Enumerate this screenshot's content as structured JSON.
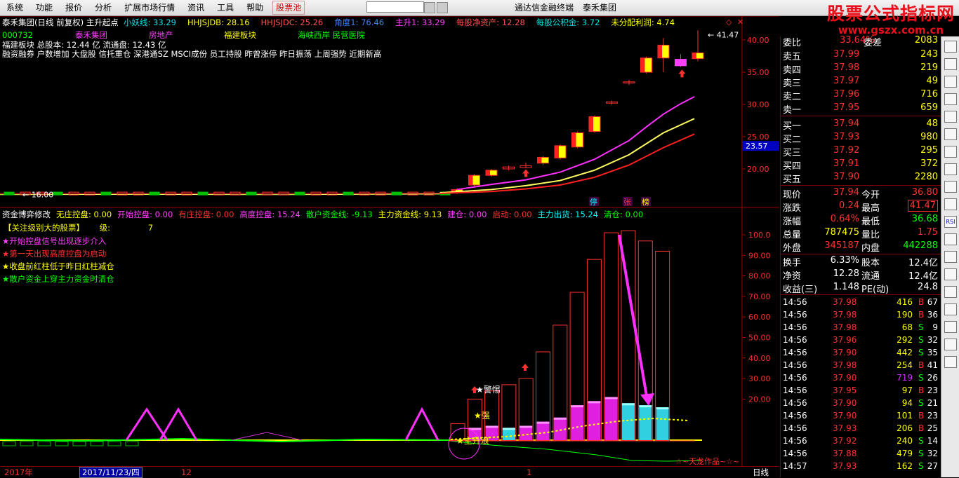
{
  "menu": {
    "items": [
      "系统",
      "功能",
      "报价",
      "分析",
      "扩展市场行情",
      "资讯",
      "工具",
      "帮助"
    ],
    "hot": "股票池",
    "app_title": "通达信金融终端",
    "stock_name": "泰禾集团"
  },
  "watermark": {
    "line1": "股票公式指标网",
    "line2": "www.gszx.com.cn"
  },
  "main": {
    "title": "泰禾集团(日线 前复权) 主升起点",
    "indicators": [
      {
        "label": "小妖线: 33.29",
        "color": "#00e6e6"
      },
      {
        "label": "HHJSJDB: 28.16",
        "color": "#ffff00"
      },
      {
        "label": "HHJSJDC: 25.26",
        "color": "#ff5050"
      },
      {
        "label": "角度1: 76.46",
        "color": "#3f7fff"
      },
      {
        "label": "主升1: 33.29",
        "color": "#ff40ff"
      },
      {
        "label": "每股净资产: 12.28",
        "color": "#ff5050"
      },
      {
        "label": "每股公积金: 3.72",
        "color": "#00e0e0"
      },
      {
        "label": "未分配利润: 4.74",
        "color": "#ffff00"
      }
    ],
    "row2": [
      {
        "label": "000732",
        "color": "#00ff00"
      },
      {
        "label": "泰禾集团",
        "color": "#ff40ff"
      },
      {
        "label": "房地产",
        "color": "#ff40ff"
      },
      {
        "label": "福建板块",
        "color": "#ffff00"
      },
      {
        "label": "海峡西岸 民营医院",
        "color": "#00ff00"
      }
    ],
    "row3": "福建板块  总股本: 12.44 亿      流通盘: 12.43 亿",
    "row4": "融资融券 户数增加 大盘股 信托重仓 深港通SZ MSCI成份 员工持股 昨曾涨停 昨日振荡 上周强势 近期新高",
    "price_ticks": [
      "40.00",
      "35.00",
      "30.00",
      "25.00",
      "20.00"
    ],
    "current_price_tag": "23.57",
    "high_label": "41.47",
    "low_label": "16.00",
    "tags": [
      "停",
      "张",
      "榜"
    ]
  },
  "sub": {
    "title_items": [
      {
        "label": "资金博弈修改",
        "color": "#ffffff"
      },
      {
        "label": "无庄控盘: 0.00",
        "color": "#ffff00"
      },
      {
        "label": "开始控盘: 0.00",
        "color": "#ff40ff"
      },
      {
        "label": "有庄控盘: 0.00",
        "color": "#ff3030"
      },
      {
        "label": "高度控盘: 15.24",
        "color": "#ff40ff"
      },
      {
        "label": "散户资金线: -9.13",
        "color": "#00ff00"
      },
      {
        "label": "主力资金线: 9.13",
        "color": "#ffff00"
      },
      {
        "label": "建仓: 0.00",
        "color": "#ff40ff"
      },
      {
        "label": "启动: 0.00",
        "color": "#ff3030"
      },
      {
        "label": "主力出货: 15.24",
        "color": "#00ffff"
      },
      {
        "label": "清仓: 0.00",
        "color": "#00ff00"
      }
    ],
    "focus": "【关注级别大的股票】",
    "level_label": "级:",
    "level_value": "7",
    "legend": [
      {
        "text": "★开始控盘信号出现逐步介入",
        "color": "#ff40ff"
      },
      {
        "text": "★第一天出现高度控盘为启动",
        "color": "#ff3030"
      },
      {
        "text": "★收盘前红柱低于昨日红柱减仓",
        "color": "#ffff00"
      },
      {
        "text": "★散户资金上穿主力资金时清仓",
        "color": "#00ff00"
      }
    ],
    "ticks": [
      "100.0",
      "90.00",
      "80.00",
      "70.00",
      "60.00",
      "50.00",
      "40.00",
      "30.00",
      "20.00"
    ],
    "annot_warn": "★警惕",
    "annot_strong": "★强",
    "annot_main": "★主升浪",
    "signature": "☆~天龙作品~☆~"
  },
  "bottom": {
    "year": "2017年",
    "date": "2017/11/23/四",
    "m12": "12",
    "m1": "1",
    "period": "日线"
  },
  "orderbook": {
    "header": {
      "label1": "委比",
      "val1": "33.64%",
      "label2": "委差",
      "val2": "2083"
    },
    "asks": [
      {
        "label": "卖五",
        "price": "37.99",
        "vol": "243"
      },
      {
        "label": "卖四",
        "price": "37.98",
        "vol": "219"
      },
      {
        "label": "卖三",
        "price": "37.97",
        "vol": "49"
      },
      {
        "label": "卖二",
        "price": "37.96",
        "vol": "716"
      },
      {
        "label": "卖一",
        "price": "37.95",
        "vol": "659"
      }
    ],
    "bids": [
      {
        "label": "买一",
        "price": "37.94",
        "vol": "48"
      },
      {
        "label": "买二",
        "price": "37.93",
        "vol": "980"
      },
      {
        "label": "买三",
        "price": "37.92",
        "vol": "295"
      },
      {
        "label": "买四",
        "price": "37.91",
        "vol": "372"
      },
      {
        "label": "买五",
        "price": "37.90",
        "vol": "2280"
      }
    ]
  },
  "quote": [
    {
      "l1": "现价",
      "v1": "37.94",
      "c1": "#ff3030",
      "l2": "今开",
      "v2": "36.80",
      "c2": "#ff3030"
    },
    {
      "l1": "涨跌",
      "v1": "0.24",
      "c1": "#ff3030",
      "l2": "最高",
      "v2": "41.47",
      "c2": "#ff3030",
      "box2": true
    },
    {
      "l1": "涨幅",
      "v1": "0.64%",
      "c1": "#ff3030",
      "l2": "最低",
      "v2": "36.68",
      "c2": "#00ff00"
    },
    {
      "l1": "总量",
      "v1": "787475",
      "c1": "#ffff00",
      "l2": "量比",
      "v2": "1.75",
      "c2": "#ff3030"
    },
    {
      "l1": "外盘",
      "v1": "345187",
      "c1": "#ff3030",
      "l2": "内盘",
      "v2": "442288",
      "c2": "#00ff00"
    }
  ],
  "fundamentals": [
    {
      "l1": "换手",
      "v1": "6.33%",
      "l2": "股本",
      "v2": "12.4亿"
    },
    {
      "l1": "净资",
      "v1": "12.28",
      "l2": "流通",
      "v2": "12.4亿"
    },
    {
      "l1": "收益(三)",
      "v1": "1.148",
      "l2": "PE(动)",
      "v2": "24.8"
    }
  ],
  "ticks_list": [
    {
      "t": "14:56",
      "p": "37.98",
      "v": "416",
      "bs": "B",
      "n": "67"
    },
    {
      "t": "14:56",
      "p": "37.98",
      "v": "190",
      "bs": "B",
      "n": "36"
    },
    {
      "t": "14:56",
      "p": "37.98",
      "v": "68",
      "bs": "S",
      "n": "9"
    },
    {
      "t": "14:56",
      "p": "37.96",
      "v": "292",
      "bs": "S",
      "n": "32"
    },
    {
      "t": "14:56",
      "p": "37.90",
      "v": "442",
      "bs": "S",
      "n": "35"
    },
    {
      "t": "14:56",
      "p": "37.98",
      "v": "254",
      "bs": "B",
      "n": "41"
    },
    {
      "t": "14:56",
      "p": "37.90",
      "v": "719",
      "bs": "S",
      "n": "26"
    },
    {
      "t": "14:56",
      "p": "37.95",
      "v": "97",
      "bs": "B",
      "n": "23"
    },
    {
      "t": "14:56",
      "p": "37.90",
      "v": "94",
      "bs": "S",
      "n": "21"
    },
    {
      "t": "14:56",
      "p": "37.90",
      "v": "101",
      "bs": "B",
      "n": "23"
    },
    {
      "t": "14:56",
      "p": "37.93",
      "v": "206",
      "bs": "B",
      "n": "25"
    },
    {
      "t": "14:56",
      "p": "37.92",
      "v": "240",
      "bs": "S",
      "n": "14"
    },
    {
      "t": "14:56",
      "p": "37.88",
      "v": "479",
      "bs": "S",
      "n": "32"
    },
    {
      "t": "14:57",
      "p": "37.93",
      "v": "162",
      "bs": "S",
      "n": "27"
    }
  ],
  "toolbar_icons": [
    "list-icon",
    "grid-icon",
    "bars-icon",
    "table-icon",
    "chart-icon",
    "pulse-icon",
    "doc-icon",
    "person-icon",
    "line-icon",
    "candle-icon",
    "rsi-icon",
    "clock-icon",
    "move-icon",
    "plus-icon",
    "minus-icon",
    "doc-icon",
    "book-icon",
    "window-icon",
    "tool-icon"
  ],
  "chart_data": {
    "type": "candlestick",
    "price_axis": {
      "ticks": [
        40,
        35,
        30,
        25,
        20
      ],
      "current": 23.57,
      "high": 41.47,
      "low": 16.0
    },
    "candles": [
      {
        "o": 16.3,
        "c": 16.8,
        "h": 17.0,
        "l": 16.1
      },
      {
        "o": 17.5,
        "c": 19.0,
        "h": 19.2,
        "l": 17.2
      },
      {
        "o": 19.0,
        "c": 19.8,
        "h": 20.0,
        "l": 18.8
      },
      {
        "o": 20.3,
        "c": 20.0,
        "h": 20.5,
        "l": 19.8
      },
      {
        "o": 20.2,
        "c": 20.5,
        "h": 21.0,
        "l": 20.1
      },
      {
        "o": 20.9,
        "c": 21.8,
        "h": 22.0,
        "l": 20.6
      },
      {
        "o": 21.7,
        "c": 23.6,
        "h": 23.8,
        "l": 21.5
      },
      {
        "o": 23.4,
        "c": 25.6,
        "h": 25.8,
        "l": 23.2
      },
      {
        "o": 25.8,
        "c": 28.1,
        "h": 28.3,
        "l": 25.6
      },
      {
        "o": 30.2,
        "c": 30.4,
        "h": 30.6,
        "l": 30.0
      },
      {
        "o": 33.4,
        "c": 33.5,
        "h": 33.8,
        "l": 33.0
      },
      {
        "o": 35.0,
        "c": 37.2,
        "h": 37.4,
        "l": 34.8
      },
      {
        "o": 37.2,
        "c": 39.2,
        "h": 40.3,
        "l": 35.0
      },
      {
        "o": 37.0,
        "c": 36.0,
        "h": 37.8,
        "l": 35.8
      },
      {
        "o": 37.1,
        "c": 38.0,
        "h": 41.5,
        "l": 36.7
      }
    ],
    "volume_axis": {
      "ticks": [
        100,
        90,
        80,
        70,
        60,
        50,
        40,
        30,
        20
      ]
    },
    "volume_bars": [
      {
        "outer": 8,
        "inner": 0
      },
      {
        "outer": 20,
        "inner": 6
      },
      {
        "outer": 24,
        "inner": 7
      },
      {
        "outer": 27,
        "inner": 6
      },
      {
        "outer": 30,
        "inner": 7
      },
      {
        "outer": 43,
        "inner": 9
      },
      {
        "outer": 56,
        "inner": 11
      },
      {
        "outer": 72,
        "inner": 17
      },
      {
        "outer": 88,
        "inner": 19
      },
      {
        "outer": 101,
        "inner": 21
      },
      {
        "outer": 102,
        "inner": 18
      },
      {
        "outer": 97,
        "inner": 17
      },
      {
        "outer": 92,
        "inner": 16
      }
    ]
  }
}
